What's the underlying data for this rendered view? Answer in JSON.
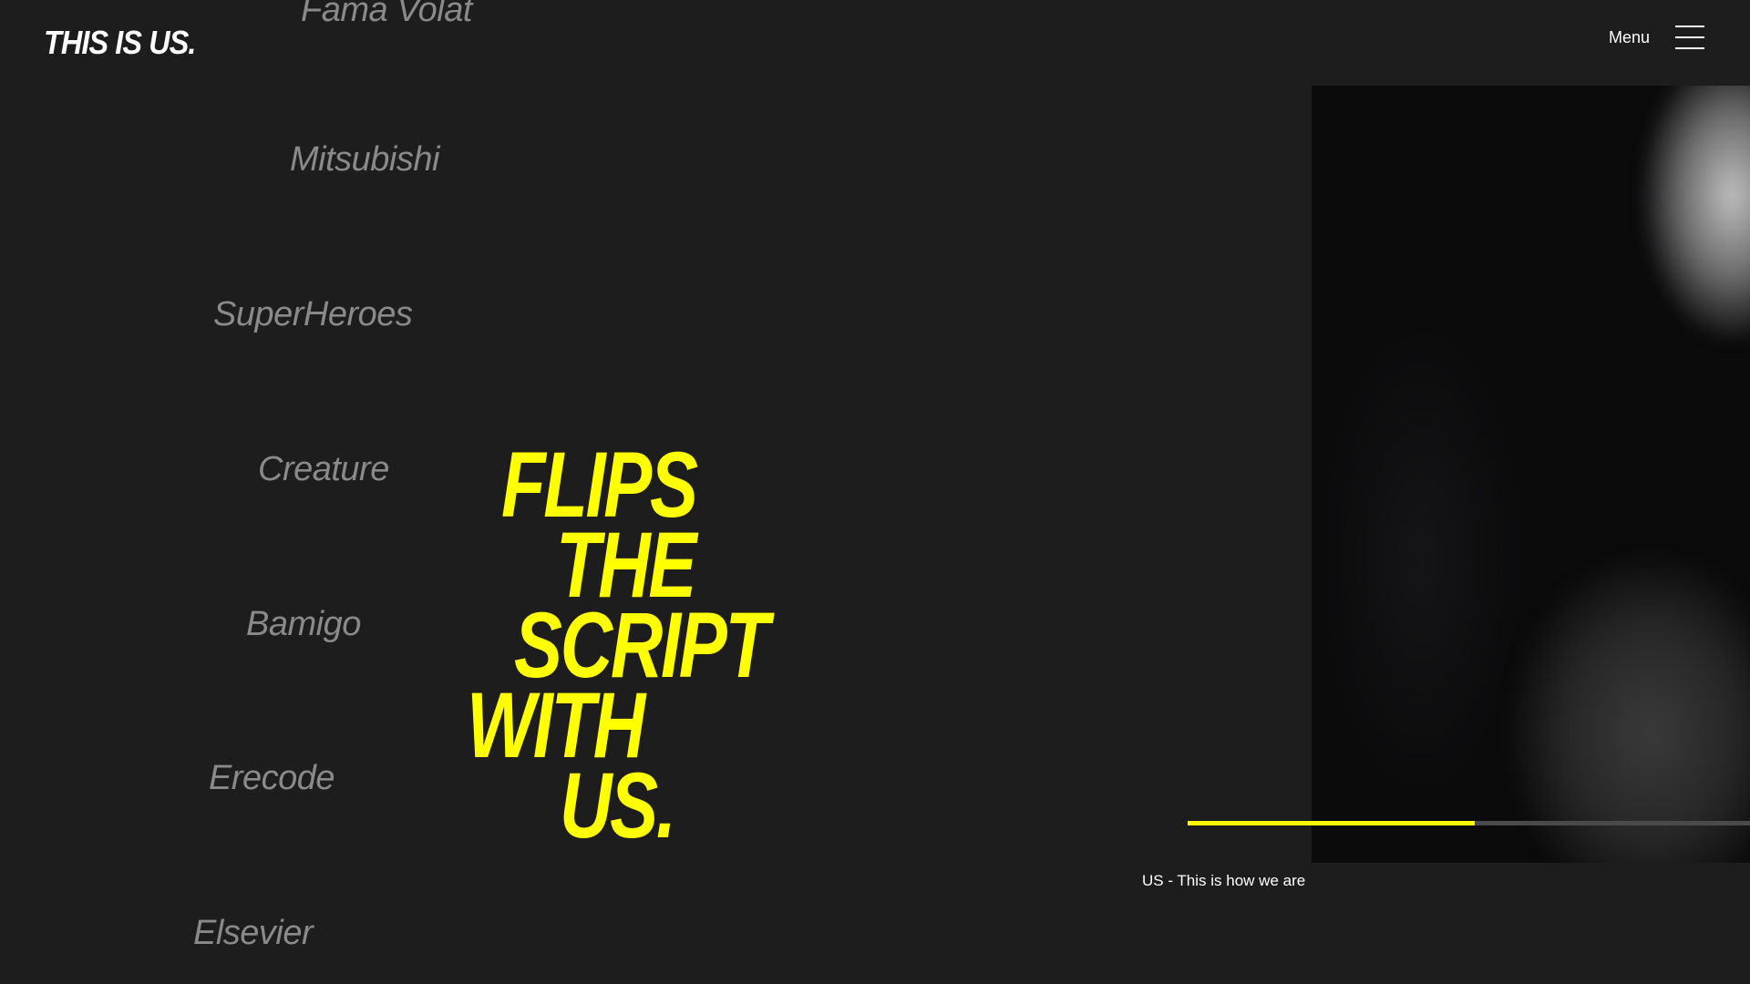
{
  "header": {
    "logo_text": "THIS IS US.",
    "menu_label": "Menu"
  },
  "clients": [
    "Fama Volat",
    "Mitsubishi",
    "SuperHeroes",
    "Creature",
    "Bamigo",
    "Erecode",
    "Elsevier"
  ],
  "headline": {
    "lines": [
      "FLIPS",
      "THE",
      "SCRIPT",
      "WITH",
      "US."
    ]
  },
  "video": {
    "caption": "US - This is how we are",
    "progress_fraction": 0.51
  },
  "colors": {
    "background": "#1d1d1d",
    "accent": "#ffff00",
    "client_text": "#8a8a8a",
    "white": "#ffffff"
  }
}
